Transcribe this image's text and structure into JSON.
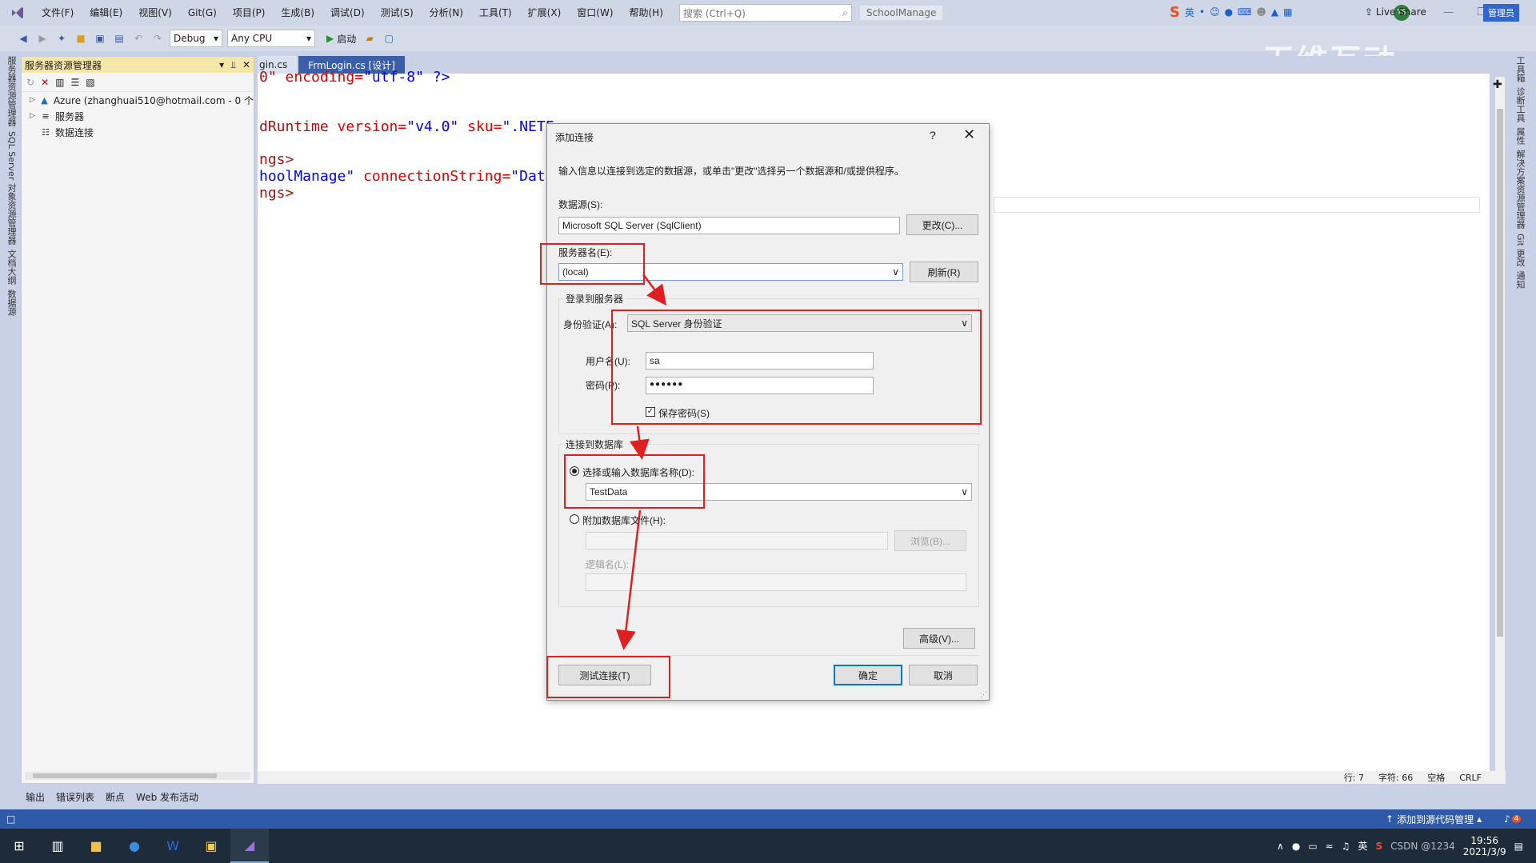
{
  "menu": {
    "items": [
      "文件(F)",
      "编辑(E)",
      "视图(V)",
      "Git(G)",
      "项目(P)",
      "生成(B)",
      "调试(D)",
      "测试(S)",
      "分析(N)",
      "工具(T)",
      "扩展(X)",
      "窗口(W)",
      "帮助(H)"
    ],
    "search_placeholder": "搜索 (Ctrl+Q)",
    "solution_name": "SchoolManage",
    "avatar_initials": "TS"
  },
  "toolbar": {
    "config": "Debug",
    "platform": "Any CPU",
    "run_label": "启动",
    "live_share": "Live Share",
    "admin": "管理员",
    "ime_label": "英"
  },
  "watermark": "无维互动",
  "server_explorer": {
    "title": "服务器资源管理器",
    "nodes": [
      {
        "label": "Azure (zhanghuai510@hotmail.com - 0 个"
      },
      {
        "label": "服务器"
      },
      {
        "label": "数据连接"
      }
    ]
  },
  "left_vtabs": [
    "服务器资源管理器",
    "SQL Server 对象资源管理器",
    "文档大纲",
    "数据源"
  ],
  "right_vtabs": [
    "工具箱",
    "诊断工具",
    "属性",
    "解决方案资源管理器",
    "Git 更改",
    "通知"
  ],
  "doc_tabs": [
    "gin.cs",
    "FrmLogin.cs [设计]"
  ],
  "code": {
    "l1_a": "0\"",
    "l1_b": " encoding=",
    "l1_c": "\"utf-8\"",
    "l1_d": " ?>",
    "l2_a": "dRuntime",
    "l2_b": " version=",
    "l2_c": "\"v4.0\"",
    "l2_d": " sku=",
    "l2_e": "\".NETFr",
    "l3_a": "ngs>",
    "l4_a": "hoolManage\"",
    "l4_b": " connectionString=",
    "l4_c": "\"Data",
    "l5_a": "ngs>"
  },
  "editor_status": {
    "line": "行: 7",
    "char": "字符: 66",
    "space": "空格",
    "crlf": "CRLF"
  },
  "bottom_tabs": [
    "输出",
    "错误列表",
    "断点",
    "Web 发布活动"
  ],
  "statusbar": {
    "source_control": "添加到源代码管理",
    "notifications": "4"
  },
  "taskbar": {
    "time": "19:56",
    "date": "2021/3/9",
    "ime": "英",
    "csdn": "CSDN @1234"
  },
  "dialog": {
    "title": "添加连接",
    "help": "?",
    "intro": "输入信息以连接到选定的数据源，或单击\"更改\"选择另一个数据源和/或提供程序。",
    "datasource_label": "数据源(S):",
    "datasource_value": "Microsoft SQL Server (SqlClient)",
    "change_button": "更改(C)...",
    "server_label": "服务器名(E):",
    "server_value": "(local)",
    "refresh_button": "刷新(R)",
    "login_group": "登录到服务器",
    "auth_label": "身份验证(A):",
    "auth_value": "SQL Server 身份验证",
    "user_label": "用户名(U):",
    "user_value": "sa",
    "password_label": "密码(P):",
    "password_value": "●●●●●●",
    "save_password": "保存密码(S)",
    "db_group": "连接到数据库",
    "select_db_label": "选择或输入数据库名称(D):",
    "db_value": "TestData",
    "attach_label": "附加数据库文件(H):",
    "browse_button": "浏览(B)...",
    "logical_label": "逻辑名(L):",
    "advanced_button": "高级(V)...",
    "test_button": "测试连接(T)",
    "ok_button": "确定",
    "cancel_button": "取消"
  },
  "colors": {
    "accent": "#2f5aa8",
    "annotation": "#e02020",
    "panel_header": "#f6e7a8"
  }
}
